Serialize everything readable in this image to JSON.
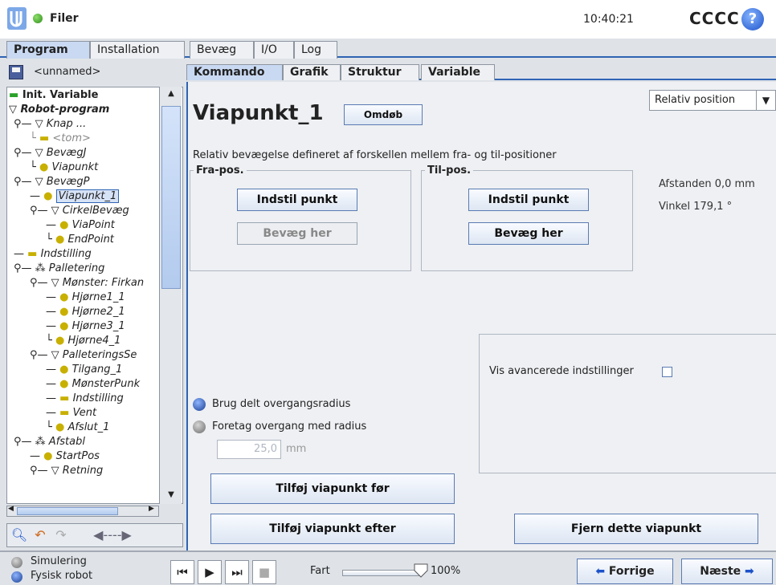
{
  "topbar": {
    "file_label": "Filer",
    "time": "10:40:21",
    "robot_name": "CCCC",
    "help_symbol": "?"
  },
  "main_tabs": [
    {
      "label": "Program",
      "active": true
    },
    {
      "label": "Installation",
      "active": false
    },
    {
      "label": "Bevæg",
      "active": false
    },
    {
      "label": "I/O",
      "active": false
    },
    {
      "label": "Log",
      "active": false
    }
  ],
  "program": {
    "doc_name": "<unnamed>"
  },
  "tree": [
    "Init. Variable",
    "Robot-program",
    "Knap ...",
    "<tom>",
    "BevægJ",
    "Viapunkt",
    "BevægP",
    "Viapunkt_1",
    "CirkelBevæg",
    "ViaPoint",
    "EndPoint",
    "Indstilling",
    "Palletering",
    "Mønster: Firkan",
    "Hjørne1_1",
    "Hjørne2_1",
    "Hjørne3_1",
    "Hjørne4_1",
    "PalleteringsSe",
    "Tilgang_1",
    "MønsterPunk",
    "Indstilling",
    "Vent",
    "Afslut_1",
    "Afstabl",
    "StartPos",
    "Retning"
  ],
  "sub_tabs": [
    {
      "label": "Kommando",
      "active": true
    },
    {
      "label": "Grafik",
      "active": false
    },
    {
      "label": "Struktur",
      "active": false
    },
    {
      "label": "Variable",
      "active": false
    }
  ],
  "waypoint": {
    "title": "Viapunkt_1",
    "rename_label": "Omdøb",
    "position_mode": "Relativ position",
    "description": "Relativ bevægelse defineret af forskellen mellem fra- og til-positioner",
    "from_title": "Fra-pos.",
    "to_title": "Til-pos.",
    "set_point_label": "Indstil punkt",
    "move_here_label": "Bevæg her",
    "distance": "Afstanden 0,0 mm",
    "angle": "Vinkel 179,1 °",
    "advanced_label": "Vis avancerede indstillinger",
    "shared_radius_label": "Brug delt overgangsradius",
    "custom_radius_label": "Foretag overgang med radius",
    "radius_value": "25,0",
    "radius_unit": "mm",
    "add_before_label": "Tilføj viapunkt før",
    "add_after_label": "Tilføj viapunkt efter",
    "remove_label": "Fjern dette viapunkt"
  },
  "bottom": {
    "simulation_label": "Simulering",
    "real_robot_label": "Fysisk robot",
    "speed_label": "Fart",
    "speed_value": "100%",
    "speed_fraction": 1.0,
    "prev_label": "Forrige",
    "next_label": "Næste"
  },
  "colors": {
    "accent": "#2f64b4",
    "tab_active": "#c9d9f2",
    "panel_bg": "#eef0f3"
  }
}
